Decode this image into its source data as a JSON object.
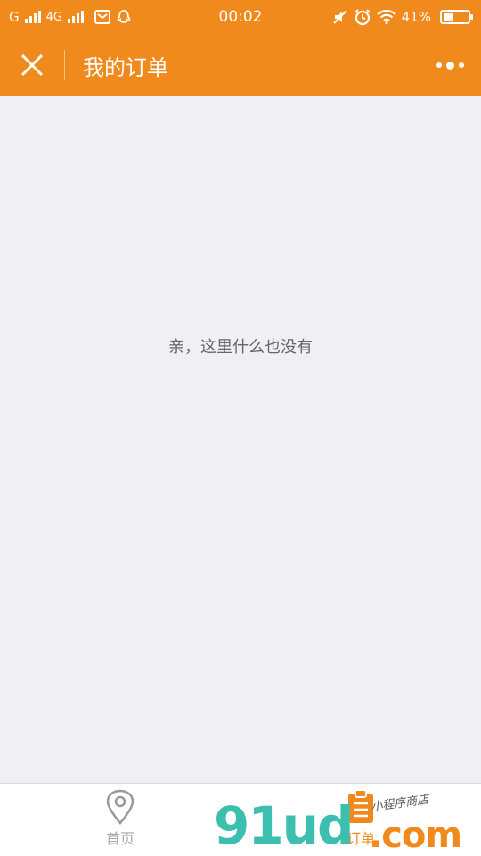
{
  "status_bar": {
    "carrier_1": "G",
    "carrier_2": "4G",
    "time": "00:02",
    "battery_percent": "41%",
    "battery_level": 0.41,
    "icons": [
      "signal-icon",
      "mail-icon",
      "qq-icon",
      "mute-icon",
      "alarm-icon",
      "wifi-icon",
      "battery-icon"
    ]
  },
  "nav": {
    "title": "我的订单",
    "close_icon": "close-icon",
    "more_icon": "more-icon"
  },
  "main": {
    "empty_message": "亲，这里什么也没有"
  },
  "tab_bar": {
    "tabs": [
      {
        "label": "首页",
        "icon": "location-pin-icon",
        "active": false
      },
      {
        "label": "订单",
        "icon": "order-list-icon",
        "active": true
      }
    ]
  },
  "watermark": {
    "brand": "91ud",
    "domain": ".com",
    "tagline": "小程序商店"
  },
  "colors": {
    "accent": "#f18a1c",
    "background": "#efeff4",
    "inactive_tab": "#aaaaaa",
    "watermark_teal": "#3dbfb0"
  }
}
